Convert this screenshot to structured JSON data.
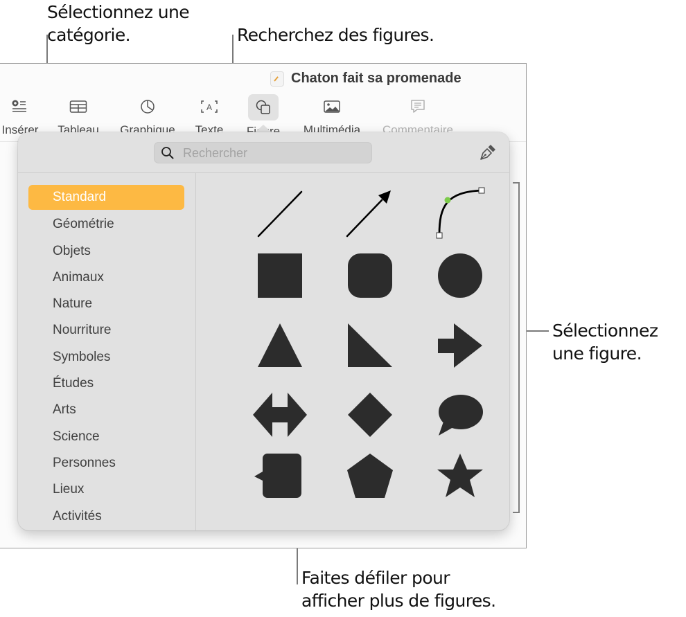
{
  "callouts": {
    "category": [
      "Sélectionnez une",
      "catégorie."
    ],
    "search": "Recherchez des figures.",
    "shape": [
      "Sélectionnez",
      "une figure."
    ],
    "scroll": [
      "Faites défiler pour",
      "afficher plus de figures."
    ]
  },
  "window": {
    "title": "Chaton fait sa promenade",
    "toolbar": [
      {
        "label": "Insérer",
        "icon": "insert-list-icon"
      },
      {
        "label": "Tableau",
        "icon": "table-icon"
      },
      {
        "label": "Graphique",
        "icon": "chart-icon"
      },
      {
        "label": "Texte",
        "icon": "text-box-icon"
      },
      {
        "label": "Figure",
        "icon": "shape-icon",
        "active": true
      },
      {
        "label": "Multimédia",
        "icon": "media-icon"
      },
      {
        "label": "Commentaire",
        "icon": "comment-icon",
        "disabled": true
      }
    ]
  },
  "popover": {
    "search_placeholder": "Rechercher",
    "categories": [
      "Standard",
      "Géométrie",
      "Objets",
      "Animaux",
      "Nature",
      "Nourriture",
      "Symboles",
      "Études",
      "Arts",
      "Science",
      "Personnes",
      "Lieux",
      "Activités"
    ],
    "selected_category": "Standard",
    "shapes": [
      "line",
      "arrow-line",
      "curve",
      "square",
      "rounded-square",
      "circle",
      "triangle",
      "right-triangle",
      "arrow-right",
      "double-arrow",
      "diamond",
      "speech-bubble",
      "callout-square",
      "pentagon",
      "star"
    ],
    "colors": {
      "selected": "#fdb943",
      "shape_fill": "#2c2c2c",
      "curve_handle": "#7ccb4a"
    }
  }
}
